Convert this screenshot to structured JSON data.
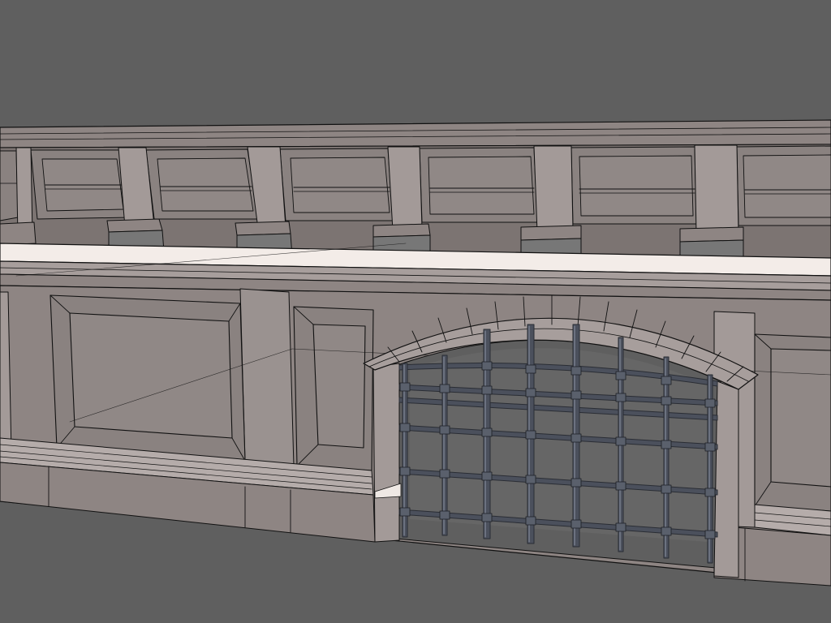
{
  "scene": {
    "subject": "3d-wall-with-balustrade-and-iron-gate",
    "view": "wireframe-on-shaded",
    "colors": {
      "background": "#5f5f5f",
      "stone": "#8e8583",
      "stone_light": "#a79e9c",
      "stone_dark": "#6e6664",
      "ledge_highlight": "#f3ece8",
      "wire": "#111111",
      "iron": "#3f4450",
      "iron_highlight": "#7d8494"
    }
  }
}
